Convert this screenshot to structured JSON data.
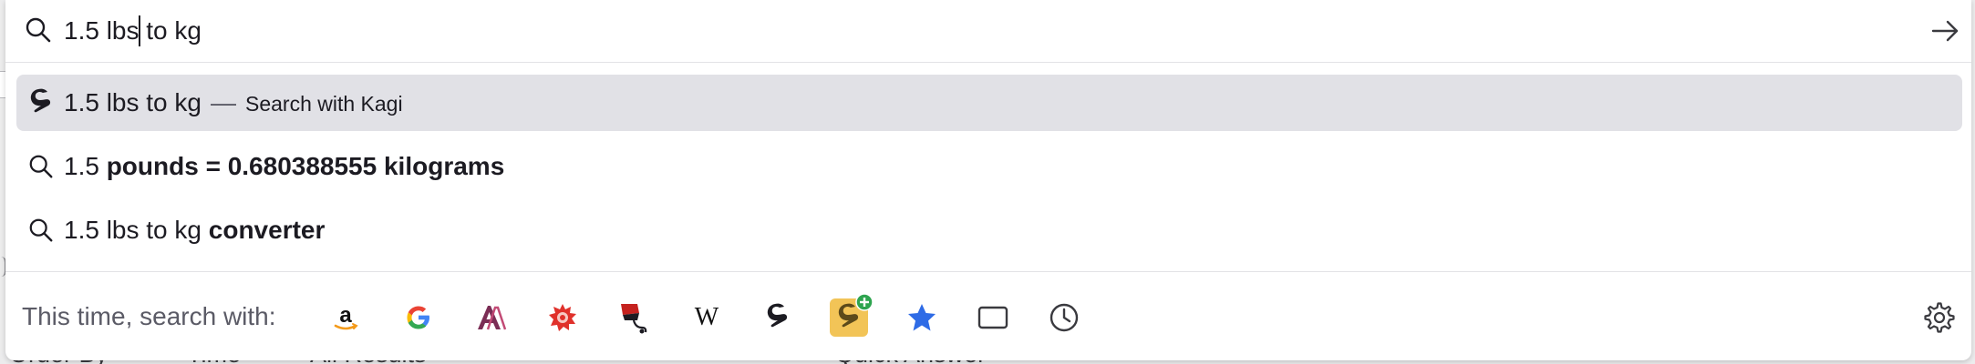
{
  "background": {
    "strip_items": [
      "Order By",
      "Time",
      "All Results",
      "Quick Answer"
    ]
  },
  "url_bar": {
    "value": "1.5 lbs to kg",
    "go_icon": "arrow-right-icon"
  },
  "results": [
    {
      "icon": "kagi-icon",
      "text": "1.5 lbs to kg",
      "separator": "—",
      "action": "Search with Kagi",
      "selected": true
    },
    {
      "icon": "search-icon",
      "text_plain": "1.5 ",
      "text_bold": "pounds = 0.680388555 kilograms"
    },
    {
      "icon": "search-icon",
      "text_plain": "1.5 lbs to kg ",
      "text_bold": "converter"
    }
  ],
  "engines_bar": {
    "label": "This time, search with:",
    "engines": [
      {
        "name": "amazon",
        "glyph": "a"
      },
      {
        "name": "google",
        "glyph": "G"
      },
      {
        "name": "anna-archive",
        "glyph": "A"
      },
      {
        "name": "badge",
        "glyph": ""
      },
      {
        "name": "flag",
        "glyph": ""
      },
      {
        "name": "wikipedia",
        "glyph": "W"
      },
      {
        "name": "kagi",
        "glyph": "g"
      },
      {
        "name": "kagi-add",
        "glyph": "g"
      },
      {
        "name": "bookmarks",
        "glyph": "★"
      },
      {
        "name": "tabs",
        "glyph": ""
      },
      {
        "name": "history",
        "glyph": ""
      }
    ],
    "settings_icon": "gear-icon"
  },
  "colors": {
    "selected_row": "#e1e1e6",
    "text": "#1c1b22",
    "muted": "#5b5b66",
    "star_blue": "#2e6be6",
    "kagi_yellow": "#f2c457"
  }
}
